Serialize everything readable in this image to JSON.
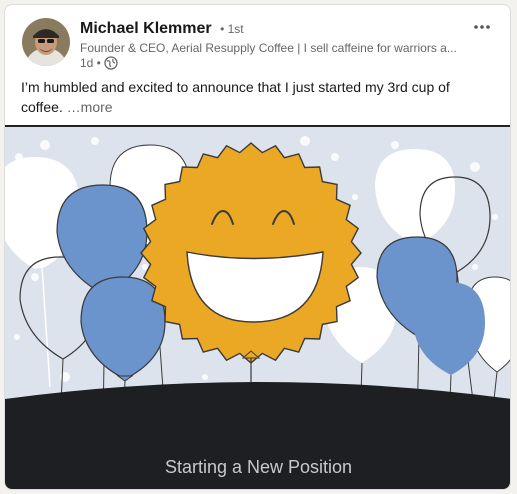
{
  "post": {
    "author_name": "Michael Klemmer",
    "degree": "• 1st",
    "headline": "Founder & CEO, Aerial Resupply Coffee | I sell caffeine for warriors a...",
    "time_ago": "1d •",
    "body_text": "I’m humbled and excited to announce that I just started my 3rd cup of coffee.",
    "see_more": "…more",
    "more_icon": "ellipsis-icon",
    "visibility_icon": "globe-icon"
  },
  "media": {
    "caption": "Starting a New Position",
    "colors": {
      "sky": "#dde3ec",
      "balloon_blue": "#6b93cc",
      "sun": "#eba824",
      "ground": "#1e1f22"
    }
  }
}
